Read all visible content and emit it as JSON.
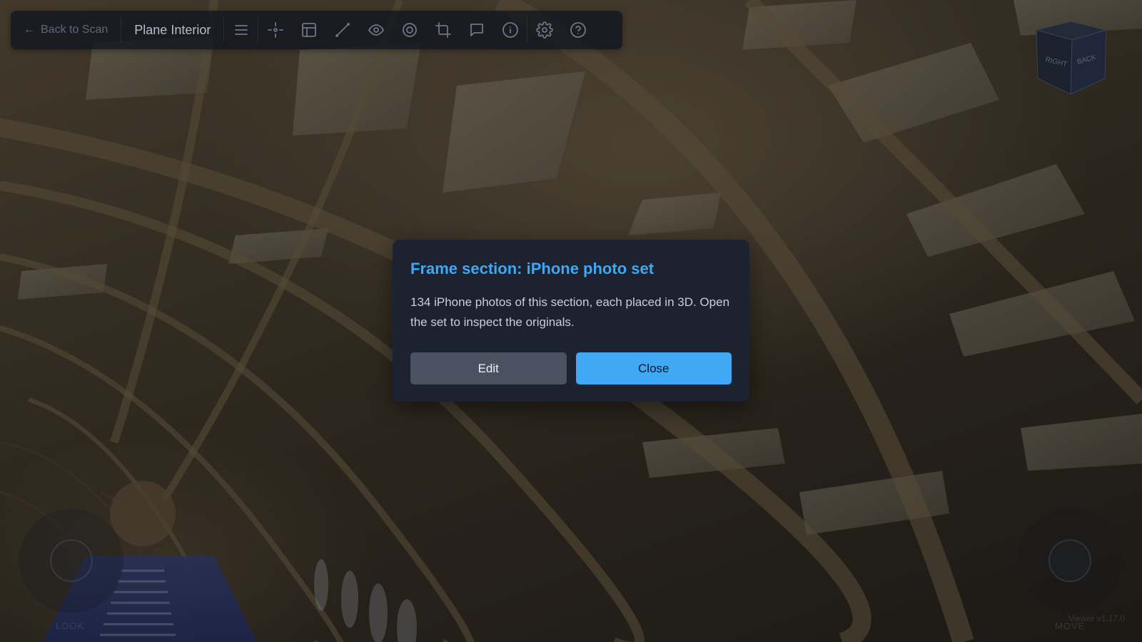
{
  "toolbar": {
    "back_label": "Back to Scan",
    "scan_title": "Plane Interior",
    "tools": [
      "menu-icon",
      "crosshair-icon",
      "layout-icon",
      "measure-line-icon",
      "eye-icon",
      "target-icon",
      "crop-icon",
      "comment-icon",
      "info-icon",
      "settings-gear-icon",
      "help-icon"
    ]
  },
  "view_cube": {
    "right_label": "RIGHT",
    "back_label": "BACK"
  },
  "joysticks": {
    "left_label": "LOOK",
    "right_label": "MOVE"
  },
  "version": "Viewer v1.17.0",
  "dialog": {
    "title": "Frame section: iPhone photo set",
    "body": "134 iPhone photos of this section, each placed in 3D. Open the set to inspect the originals.",
    "edit_label": "Edit",
    "close_label": "Close"
  },
  "colors": {
    "accent": "#3fa9f5",
    "dialog_bg": "#1c2230",
    "toolbar_bg": "#12161f"
  }
}
